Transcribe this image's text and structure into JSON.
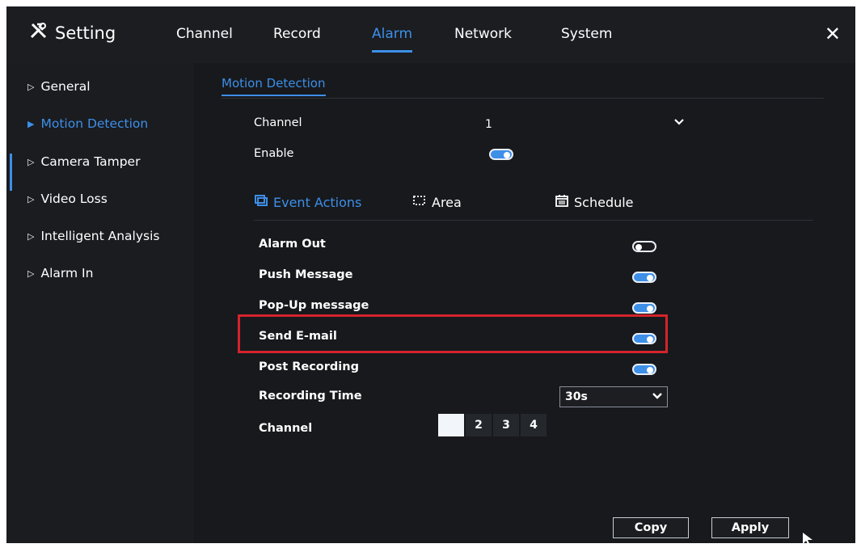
{
  "header": {
    "title": "Setting",
    "tabs": [
      "Channel",
      "Record",
      "Alarm",
      "Network",
      "System"
    ],
    "active_tab": "Alarm",
    "close_label": "✕"
  },
  "sidebar": {
    "items": [
      {
        "label": "General"
      },
      {
        "label": "Motion Detection",
        "active": true
      },
      {
        "label": "Camera Tamper"
      },
      {
        "label": "Video Loss"
      },
      {
        "label": "Intelligent Analysis"
      },
      {
        "label": "Alarm In"
      }
    ]
  },
  "main": {
    "subtab": "Motion Detection",
    "channel_label": "Channel",
    "channel_value": "1",
    "enable_label": "Enable",
    "enable_on": true,
    "event_tabs": [
      {
        "label": "Event Actions",
        "icon": "event-actions-icon",
        "active": true
      },
      {
        "label": "Area",
        "icon": "area-icon"
      },
      {
        "label": "Schedule",
        "icon": "calendar-icon"
      }
    ],
    "actions": [
      {
        "label": "Alarm Out",
        "on": false
      },
      {
        "label": "Push Message",
        "on": true
      },
      {
        "label": "Pop-Up message",
        "on": true
      },
      {
        "label": "Send E-mail",
        "on": true
      },
      {
        "label": "Post Recording",
        "on": true
      }
    ],
    "recording_time_label": "Recording Time",
    "recording_time_value": "30s",
    "channels_label": "Channel",
    "channel_boxes": [
      "1",
      "2",
      "3",
      "4"
    ],
    "selected_channel": "1",
    "copy_label": "Copy",
    "apply_label": "Apply"
  },
  "colors": {
    "accent": "#3d8fe8",
    "highlight": "#d4242b",
    "background": "#15171a"
  }
}
